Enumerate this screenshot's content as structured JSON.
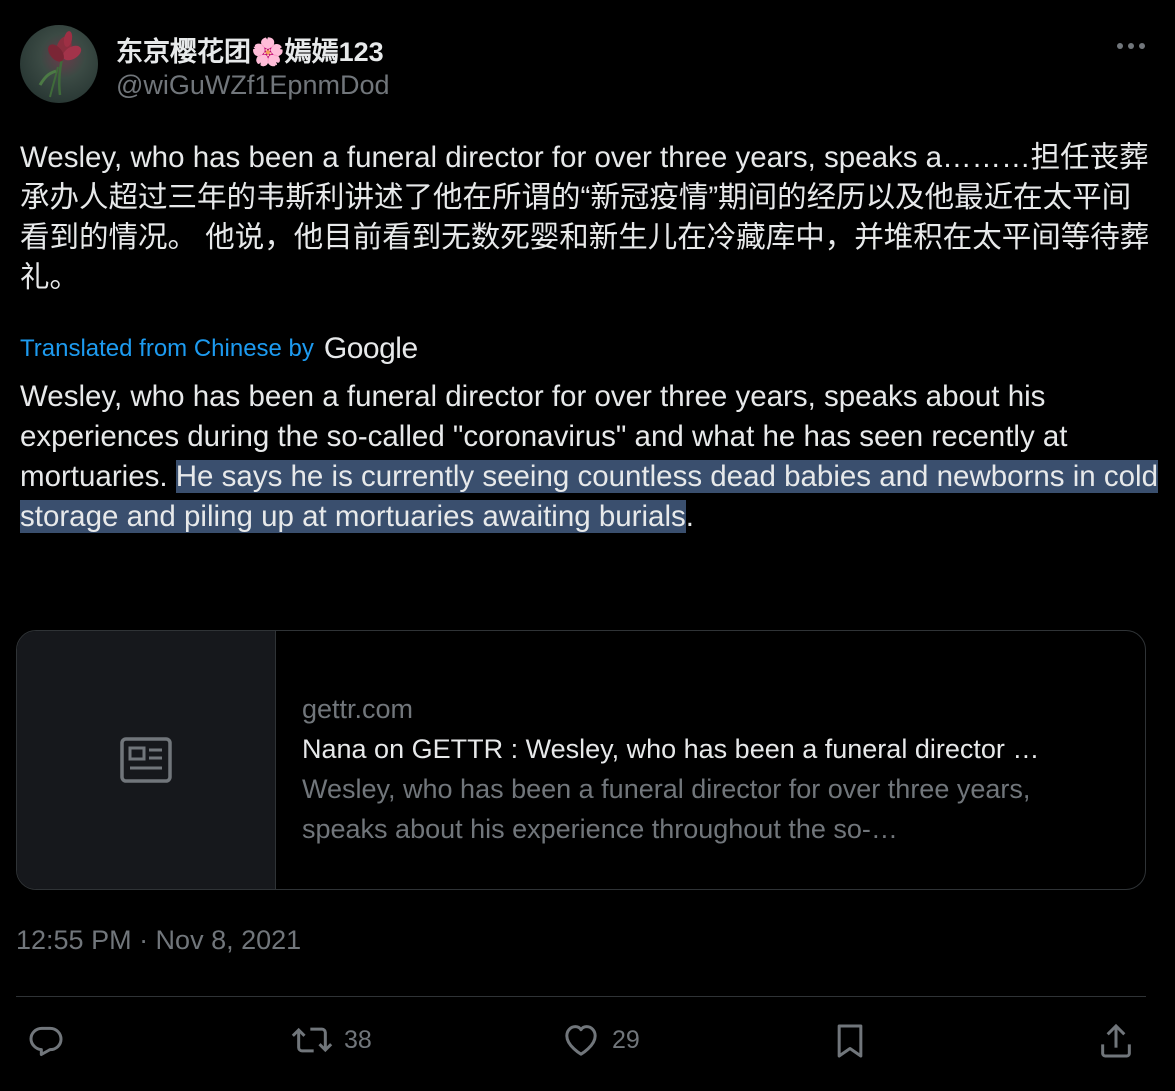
{
  "tweet": {
    "display_name": "东京樱花团🌸嫣嫣123",
    "handle": "@wiGuWZf1EpnmDod",
    "text": "Wesley, who has been a funeral director for over three years, speaks a………担任丧葬承办人超过三年的韦斯利讲述了他在所谓的“新冠疫情”期间的经历以及他最近在太平间看到的情况。 他说，他目前看到无数死婴和新生儿在冷藏库中，并堆积在太平间等待葬礼。",
    "translated_label": "Translated from Chinese by",
    "translation_provider": "Google",
    "translation_plain": "Wesley, who has been a funeral director for over three years, speaks about his experiences during the so-called \"coronavirus\" and what he has seen recently at mortuaries. ",
    "translation_highlighted": "He says he is currently seeing countless dead babies and newborns in cold storage and piling up at mortuaries awaiting burials",
    "translation_end": ".",
    "timestamp": "12:55 PM · Nov 8, 2021"
  },
  "card": {
    "domain": "gettr.com",
    "title": "Nana on GETTR : Wesley, who has been a funeral director …",
    "description": "Wesley, who has been a funeral director for over three years, speaks about his experience throughout the so-…",
    "thumb_icon": "article-icon"
  },
  "actions": {
    "reply_icon": "reply-icon",
    "retweet_icon": "retweet-icon",
    "retweet_count": "38",
    "like_icon": "heart-icon",
    "like_count": "29",
    "bookmark_icon": "bookmark-icon",
    "share_icon": "share-icon"
  },
  "colors": {
    "background": "#000000",
    "text": "#e7e9ea",
    "secondary": "#71767b",
    "link": "#1d9bf0",
    "highlight": "#3a4f6e"
  }
}
